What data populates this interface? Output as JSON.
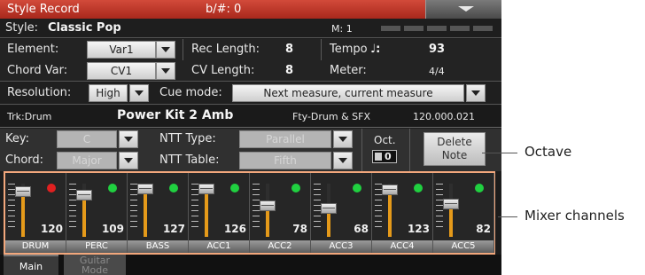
{
  "header": {
    "title": "Style Record",
    "key_signature": "b/#: 0"
  },
  "style": {
    "label": "Style:",
    "name": "Classic Pop",
    "measure": "M: 1"
  },
  "element": {
    "label": "Element:",
    "value": "Var1"
  },
  "chord_var": {
    "label": "Chord Var:",
    "value": "CV1"
  },
  "rec_length": {
    "label": "Rec Length:",
    "value": "8"
  },
  "cv_length": {
    "label": "CV Length:",
    "value": "8"
  },
  "tempo": {
    "label": "Tempo",
    "note_symbol": "♩:",
    "value": "93"
  },
  "meter": {
    "label": "Meter:",
    "value": "4/4"
  },
  "resolution": {
    "label": "Resolution:",
    "value": "High"
  },
  "cue_mode": {
    "label": "Cue mode:",
    "value": "Next measure, current measure"
  },
  "track": {
    "label": "Trk:Drum",
    "kit": "Power Kit 2 Amb",
    "category": "Fty-Drum & SFX",
    "bank": "120.000.021"
  },
  "key": {
    "label": "Key:",
    "value": "C"
  },
  "chord": {
    "label": "Chord:",
    "value": "Major"
  },
  "ntt_type": {
    "label": "NTT Type:",
    "value": "Parallel"
  },
  "ntt_table": {
    "label": "NTT Table:",
    "value": "Fifth"
  },
  "octave": {
    "label": "Oct.",
    "value": "0"
  },
  "delete_note": {
    "label": "Delete Note"
  },
  "mixer": {
    "channels": [
      {
        "name": "DRUM",
        "volume": "120",
        "level": 0.94,
        "led": "#e02020"
      },
      {
        "name": "PERC",
        "volume": "109",
        "level": 0.86,
        "led": "#20d040"
      },
      {
        "name": "BASS",
        "volume": "127",
        "level": 1.0,
        "led": "#20d040"
      },
      {
        "name": "ACC1",
        "volume": "126",
        "level": 0.99,
        "led": "#20d040"
      },
      {
        "name": "ACC2",
        "volume": "78",
        "level": 0.61,
        "led": "#20d040"
      },
      {
        "name": "ACC3",
        "volume": "68",
        "level": 0.54,
        "led": "#20d040"
      },
      {
        "name": "ACC4",
        "volume": "123",
        "level": 0.97,
        "led": "#20d040"
      },
      {
        "name": "ACC5",
        "volume": "82",
        "level": 0.65,
        "led": "#20d040"
      }
    ]
  },
  "tabs": [
    {
      "label": "Main"
    },
    {
      "label": "Guitar Mode"
    }
  ],
  "callouts": {
    "octave": "Octave",
    "mixer": "Mixer channels"
  },
  "colors": {
    "accent": "#c0392b",
    "highlight": "#f2a77c",
    "fader": "#e59a1a"
  }
}
